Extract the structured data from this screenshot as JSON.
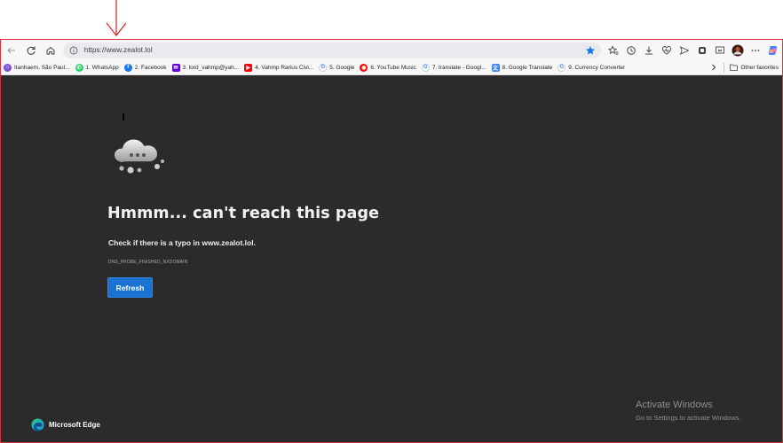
{
  "annotation": {
    "arrow_color": "#e02020"
  },
  "toolbar": {
    "url": "https://www.zealot.lol",
    "left_icons": [
      "back-icon",
      "refresh-icon",
      "home-icon"
    ],
    "right_icons": [
      "favorites-icon",
      "history-icon",
      "downloads-icon",
      "health-icon",
      "send-icon",
      "extension-icon",
      "screenshot-icon",
      "profile-avatar",
      "more-icon",
      "copilot-icon"
    ],
    "favorite_color": "#1a73e8"
  },
  "bookmarks": {
    "items": [
      {
        "label": "Itanhaem, São Paul...",
        "icon": "weather-icon",
        "color": "#7b4fd6"
      },
      {
        "label": "1. WhatsApp",
        "icon": "whatsapp-icon",
        "color": "#25d366"
      },
      {
        "label": "2. Facebook",
        "icon": "facebook-icon",
        "color": "#1877f2"
      },
      {
        "label": "3. lord_vahmp@yah...",
        "icon": "yahoo-mail-icon",
        "color": "#6001d2"
      },
      {
        "label": "4. Vahmp Rarius Civi...",
        "icon": "youtube-icon",
        "color": "#ff0000"
      },
      {
        "label": "5. Google",
        "icon": "google-icon",
        "color": "#4285f4"
      },
      {
        "label": "6. YouTube Music",
        "icon": "youtube-music-icon",
        "color": "#ff0000"
      },
      {
        "label": "7. translate - Googl...",
        "icon": "google-icon",
        "color": "#4285f4"
      },
      {
        "label": "8. Google Translate",
        "icon": "google-translate-icon",
        "color": "#4285f4"
      },
      {
        "label": "9. Currency Converter",
        "icon": "google-icon",
        "color": "#4285f4"
      }
    ],
    "other_favorites": "Other favorites"
  },
  "error": {
    "title": "Hmmm... can't reach this page",
    "description": "Check if there is a typo in www.zealot.lol.",
    "code": "DNS_PROBE_FINISHED_NXDOMAIN",
    "refresh_label": "Refresh",
    "accent": "#1a73d1"
  },
  "watermark": {
    "title": "Activate Windows",
    "subtitle": "Go to Settings to activate Windows."
  },
  "brand": {
    "label": "Microsoft Edge"
  }
}
